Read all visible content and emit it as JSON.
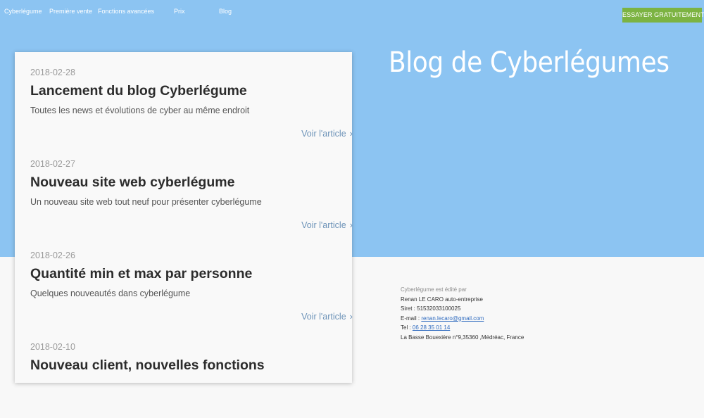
{
  "nav": {
    "items": [
      "Cyberlégume",
      "Première vente",
      "Fonctions avancées",
      "Prix",
      "Blog"
    ],
    "cta_label": "ESSAYER GRATUITEMENT"
  },
  "hero": {
    "title": "Blog de Cyberlégumes"
  },
  "posts": [
    {
      "date": "2018-02-28",
      "title": "Lancement du blog Cyberlégume",
      "summary": "Toutes les news et évolutions de cyber au même endroit",
      "link": "Voir l'article"
    },
    {
      "date": "2018-02-27",
      "title": "Nouveau site web cyberlégume",
      "summary": "Un nouveau site web tout neuf pour présenter cyberlégume",
      "link": "Voir l'article"
    },
    {
      "date": "2018-02-26",
      "title": "Quantité min et max par personne",
      "summary": "Quelques nouveautés dans cyberlégume",
      "link": "Voir l'article"
    },
    {
      "date": "2018-02-10",
      "title": "Nouveau client, nouvelles fonctions",
      "summary": "",
      "link": ""
    }
  ],
  "footer": {
    "edited_by": "Cyberlégume est édité par",
    "owner": "Renan LE CARO auto-entreprise",
    "siret": "Siret : 51532033100025",
    "email_label": "E-mail :",
    "email": "renan.lecaro@gmail.com",
    "tel_label": "Tel :",
    "tel": "06 28 35 01 14",
    "address": "La Basse Bouexière n°9,35360 ,Médréac, France"
  },
  "colors": {
    "hero_background": "#8cc4f2",
    "cta_background": "#7cb342",
    "link": "#6d93b8"
  }
}
